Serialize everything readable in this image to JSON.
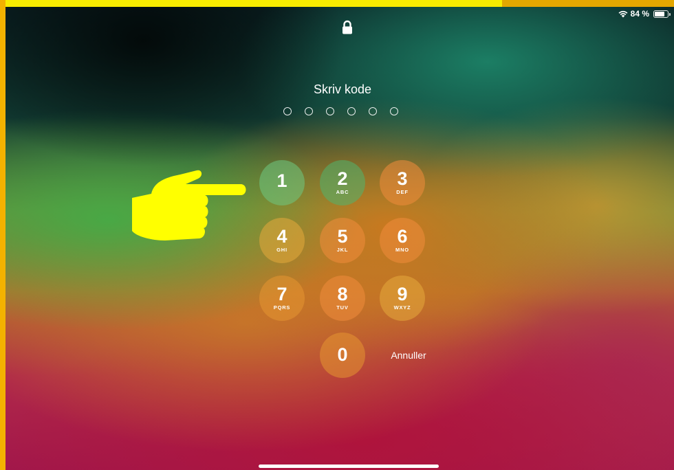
{
  "status_bar": {
    "battery_percent": "84 %",
    "battery_level": 0.84,
    "wifi_icon": "wifi-icon",
    "battery_icon": "battery-icon"
  },
  "lock_icon": "lock-icon",
  "passcode": {
    "title": "Skriv kode",
    "digit_count": 6,
    "entered": 0
  },
  "keypad": {
    "keys": [
      {
        "digit": "1",
        "letters": ""
      },
      {
        "digit": "2",
        "letters": "ABC"
      },
      {
        "digit": "3",
        "letters": "DEF"
      },
      {
        "digit": "4",
        "letters": "GHI"
      },
      {
        "digit": "5",
        "letters": "JKL"
      },
      {
        "digit": "6",
        "letters": "MNO"
      },
      {
        "digit": "7",
        "letters": "PQRS"
      },
      {
        "digit": "8",
        "letters": "TUV"
      },
      {
        "digit": "9",
        "letters": "WXYZ"
      },
      {
        "digit": "0",
        "letters": ""
      }
    ],
    "cancel_label": "Annuller"
  },
  "overlay": {
    "pointer_icon": "pointing-hand-icon",
    "color": "#ffff00",
    "frame_color": "#f3b200"
  }
}
